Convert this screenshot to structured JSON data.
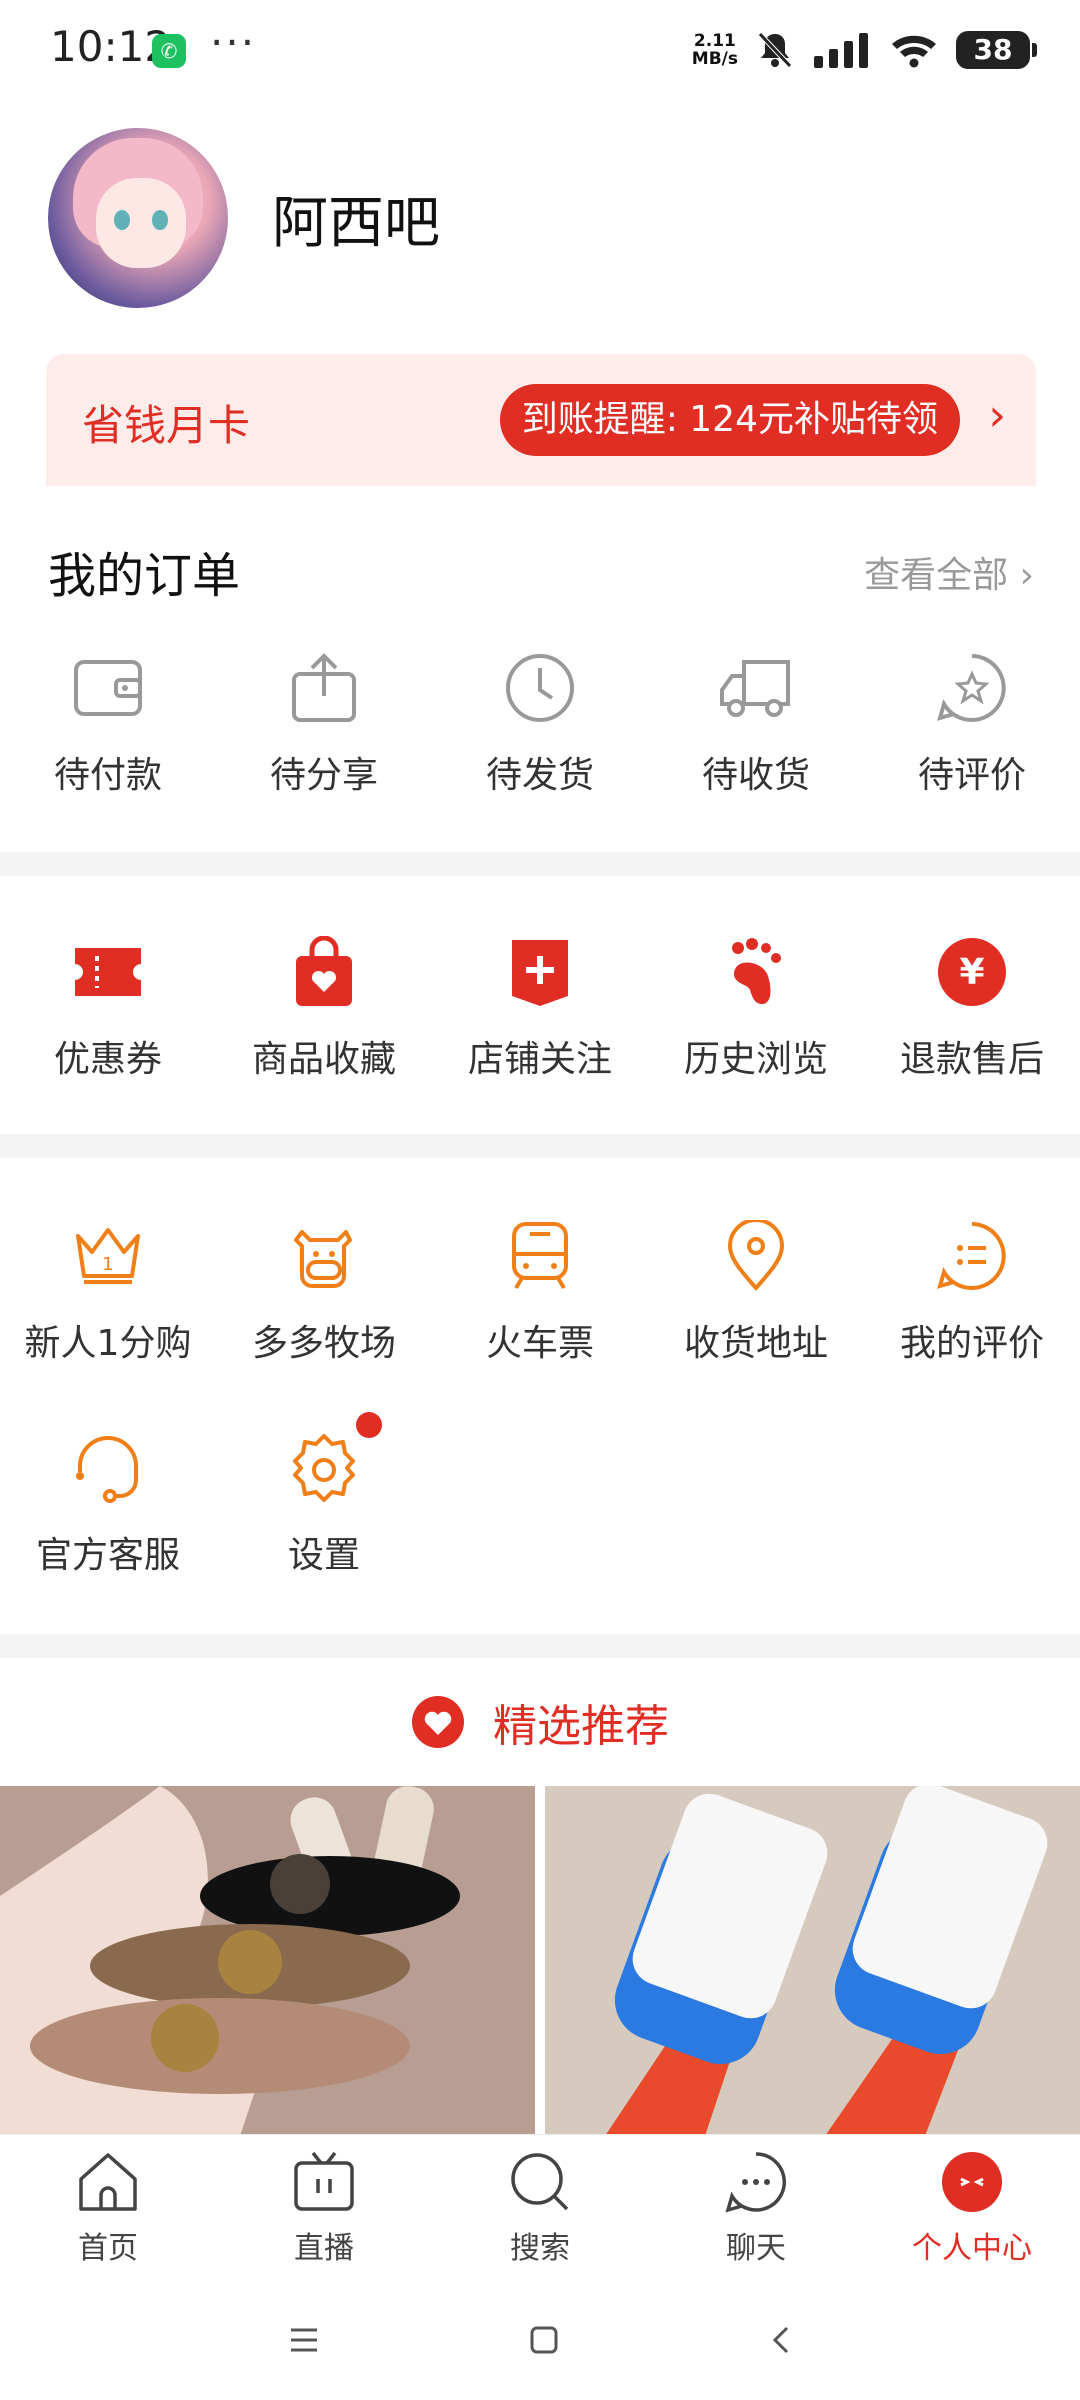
{
  "status": {
    "time": "10:12",
    "speed_top": "2.11",
    "speed_unit": "MB/s",
    "battery": "38"
  },
  "profile": {
    "name": "阿西吧"
  },
  "banner": {
    "title": "省钱月卡",
    "reminder": "到账提醒: 124元补贴待领"
  },
  "orders": {
    "title": "我的订单",
    "view_all": "查看全部",
    "items": [
      {
        "label": "待付款",
        "icon": "wallet-icon"
      },
      {
        "label": "待分享",
        "icon": "share-icon"
      },
      {
        "label": "待发货",
        "icon": "clock-icon"
      },
      {
        "label": "待收货",
        "icon": "truck-icon"
      },
      {
        "label": "待评价",
        "icon": "review-icon"
      }
    ]
  },
  "quick": [
    {
      "label": "优惠券",
      "icon": "coupon-icon"
    },
    {
      "label": "商品收藏",
      "icon": "favorite-bag-icon"
    },
    {
      "label": "店铺关注",
      "icon": "store-follow-icon"
    },
    {
      "label": "历史浏览",
      "icon": "footprint-icon"
    },
    {
      "label": "退款售后",
      "icon": "refund-icon"
    }
  ],
  "services": [
    {
      "label": "新人1分购",
      "icon": "crown-icon"
    },
    {
      "label": "多多牧场",
      "icon": "cow-icon"
    },
    {
      "label": "火车票",
      "icon": "train-icon"
    },
    {
      "label": "收货地址",
      "icon": "location-icon"
    },
    {
      "label": "我的评价",
      "icon": "comment-icon"
    },
    {
      "label": "官方客服",
      "icon": "headset-icon"
    },
    {
      "label": "设置",
      "icon": "settings-icon"
    }
  ],
  "recommend": {
    "title": "精选推荐"
  },
  "tabs": [
    {
      "label": "首页",
      "icon": "home-icon"
    },
    {
      "label": "直播",
      "icon": "tv-icon"
    },
    {
      "label": "搜索",
      "icon": "search-icon"
    },
    {
      "label": "聊天",
      "icon": "chat-icon"
    },
    {
      "label": "个人中心",
      "icon": "profile-icon",
      "active": true
    }
  ],
  "colors": {
    "accent": "#e02e24",
    "service": "#f07f18",
    "banner_bg": "#fdecea"
  }
}
